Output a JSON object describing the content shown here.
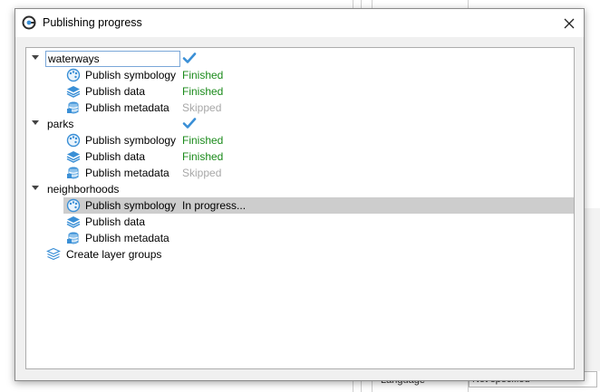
{
  "dialog": {
    "title": "Publishing progress",
    "icons": {
      "app": "app-logo-icon",
      "close": "close-icon"
    }
  },
  "background": {
    "label": "Language",
    "value": "Not specified"
  },
  "tree": {
    "layers": [
      {
        "name": "waterways",
        "completed": true,
        "tasks": [
          {
            "label": "Publish symbology",
            "status": "Finished",
            "state": "finished",
            "icon": "symbology-palette-icon"
          },
          {
            "label": "Publish data",
            "status": "Finished",
            "state": "finished",
            "icon": "data-layers-icon"
          },
          {
            "label": "Publish metadata",
            "status": "Skipped",
            "state": "skipped",
            "icon": "metadata-database-icon"
          }
        ]
      },
      {
        "name": "parks",
        "completed": true,
        "tasks": [
          {
            "label": "Publish symbology",
            "status": "Finished",
            "state": "finished",
            "icon": "symbology-palette-icon"
          },
          {
            "label": "Publish data",
            "status": "Finished",
            "state": "finished",
            "icon": "data-layers-icon"
          },
          {
            "label": "Publish metadata",
            "status": "Skipped",
            "state": "skipped",
            "icon": "metadata-database-icon"
          }
        ]
      },
      {
        "name": "neighborhoods",
        "completed": false,
        "tasks": [
          {
            "label": "Publish symbology",
            "status": "In progress...",
            "state": "progress",
            "icon": "symbology-palette-icon",
            "selected": true
          },
          {
            "label": "Publish data",
            "status": "",
            "state": "pending",
            "icon": "data-layers-icon"
          },
          {
            "label": "Publish metadata",
            "status": "",
            "state": "pending",
            "icon": "metadata-database-icon"
          }
        ]
      }
    ],
    "final_step": {
      "label": "Create layer groups",
      "icon": "layer-groups-icon"
    }
  },
  "colors": {
    "finished": "#1a8a1a",
    "skipped": "#a8a8a8",
    "icon_blue": "#3a8fd6",
    "selection": "#cdcdcd"
  }
}
